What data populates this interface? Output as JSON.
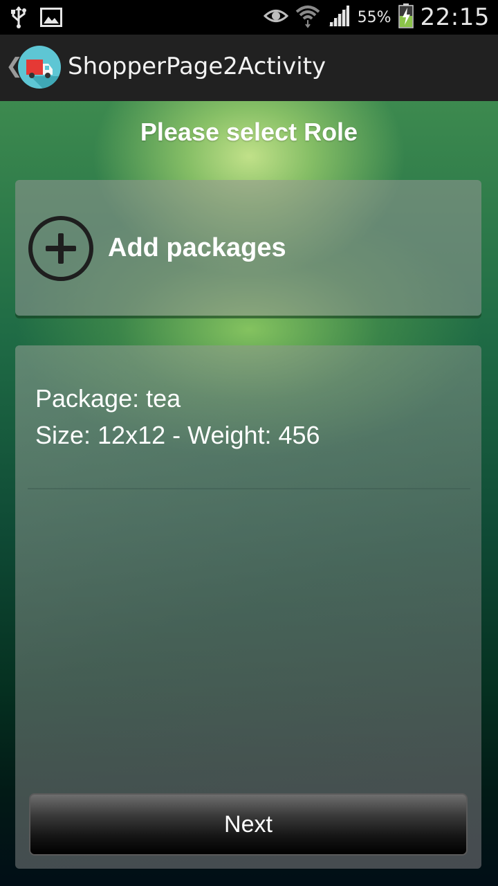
{
  "status_bar": {
    "battery_percent": "55%",
    "time": "22:15",
    "icons": [
      "usb-icon",
      "image-notification-icon",
      "eye-icon",
      "wifi-icon",
      "signal-icon",
      "battery-charging-icon"
    ]
  },
  "action_bar": {
    "title": "ShopperPage2Activity",
    "icon": "delivery-truck-icon"
  },
  "main": {
    "heading": "Please select Role",
    "add_packages_label": "Add packages",
    "add_icon": "add-circle-icon",
    "packages": [
      {
        "package_line": "Package: tea",
        "details_line": "Size: 12x12 - Weight: 456"
      }
    ],
    "next_label": "Next"
  },
  "colors": {
    "action_bar_bg": "#212121",
    "status_bar_bg": "#000000",
    "app_icon_bg": "#5ec6d4",
    "truck_red": "#e53935"
  }
}
